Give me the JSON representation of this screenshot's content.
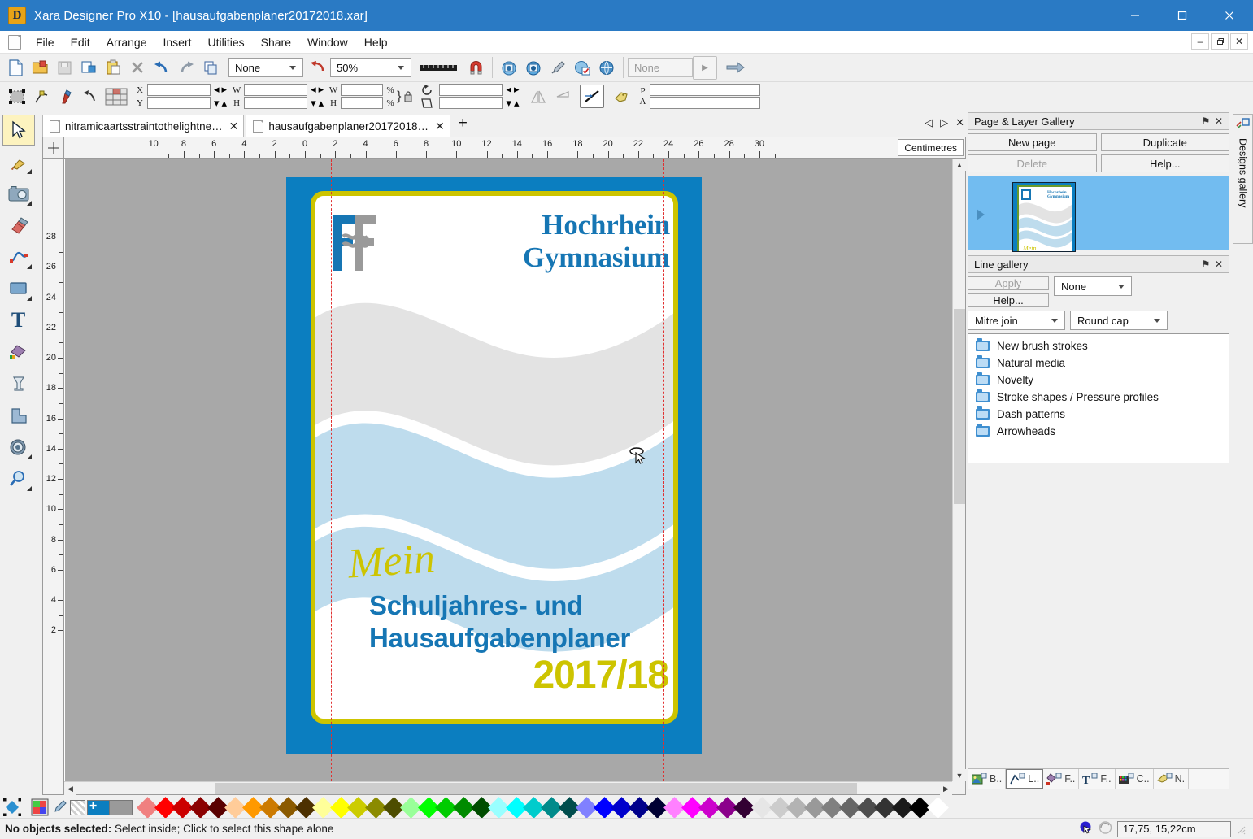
{
  "window": {
    "title": "Xara Designer Pro X10 - [hausaufgabenplaner20172018.xar]",
    "logo_letter": "D",
    "minimize": "—",
    "maximize": "☐",
    "close": "✕"
  },
  "mdi_buttons": {
    "minimize": "–",
    "restore": "❐",
    "close": "✕"
  },
  "menu": {
    "items": [
      "File",
      "Edit",
      "Arrange",
      "Insert",
      "Utilities",
      "Share",
      "Window",
      "Help"
    ]
  },
  "toolbar": {
    "buttons": [
      "new-document-icon",
      "open-document-icon",
      "save-document-icon",
      "print-icon",
      "paste-icon",
      "delete-icon",
      "undo-icon",
      "redo-icon",
      "duplicate-icon"
    ],
    "quality_value": "None",
    "zoom_value": "50%",
    "nav_buttons": [
      "previous-page-icon",
      "next-page-icon",
      "color-picker-icon",
      "web-properties-icon",
      "preview-icon"
    ],
    "name_value": "None",
    "snap_icon": "magnet-icon",
    "ruler_icon": "ruler-icon"
  },
  "infobar": {
    "x_label": "X",
    "y_label": "Y",
    "w_label": "W",
    "h_label": "H",
    "w2_label": "W",
    "h2_label": "H",
    "pct_top": "%",
    "pct_bottom": "%",
    "p_label": "P",
    "a_label": "A",
    "x_value": "",
    "y_value": "",
    "w_value": "",
    "h_value": "",
    "w2_value": "",
    "h2_value": "",
    "p_value": "",
    "a_value": ""
  },
  "tabs": {
    "items": [
      {
        "label": "nitramicaartsstraintothelightne…",
        "active": false
      },
      {
        "label": "hausaufgabenplaner20172018…",
        "active": true
      }
    ],
    "new_tab": "+",
    "close_glyph": "✕",
    "nav_prev": "◁",
    "nav_next": "▷",
    "nav_close": "✕"
  },
  "ruler": {
    "unit_label": "Centimetres",
    "horizontal_labels": [
      "10",
      "8",
      "6",
      "4",
      "2",
      "0",
      "2",
      "4",
      "6",
      "8",
      "10",
      "12",
      "14",
      "16",
      "18",
      "20",
      "22",
      "24",
      "26",
      "28",
      "30"
    ],
    "vertical_labels": [
      "28",
      "26",
      "24",
      "22",
      "20",
      "18",
      "16",
      "14",
      "12",
      "10",
      "8",
      "6",
      "4",
      "2"
    ]
  },
  "document": {
    "school_line1": "Hochrhein",
    "school_line2": "Gymnasium",
    "mein": "Mein",
    "subtitle_line1": "Schuljahres- und",
    "subtitle_line2": "Hausaufgabenplaner",
    "year": "2017/18",
    "colors": {
      "page_blue": "#0b7ec0",
      "border_yellow": "#cdc400",
      "title_blue": "#1676b4",
      "wave_grey": "#e2e2e2",
      "wave_blue": "#bcdcef",
      "logo_grey": "#9a9a9a"
    }
  },
  "page_gallery": {
    "title": "Page & Layer Gallery",
    "pin": "⚑",
    "close": "✕",
    "new_page": "New  page",
    "duplicate": "Duplicate",
    "delete": "Delete",
    "help": "Help..."
  },
  "line_gallery": {
    "title": "Line gallery",
    "pin": "⚑",
    "close": "✕",
    "apply": "Apply",
    "help": "Help...",
    "stroke_value": "None",
    "join_value": "Mitre join",
    "cap_value": "Round cap",
    "folders": [
      "New brush strokes",
      "Natural media",
      "Novelty",
      "Stroke shapes / Pressure profiles",
      "Dash patterns",
      "Arrowheads"
    ]
  },
  "gallery_tabs": [
    {
      "label": "B..",
      "icon": "bitmap-gallery-icon",
      "active": false
    },
    {
      "label": "L..",
      "icon": "line-gallery-icon",
      "active": true
    },
    {
      "label": "F..",
      "icon": "fill-gallery-icon",
      "active": false
    },
    {
      "label": "F..",
      "icon": "font-gallery-icon",
      "active": false
    },
    {
      "label": "C..",
      "icon": "color-gallery-icon",
      "active": false
    },
    {
      "label": "N.",
      "icon": "name-gallery-icon",
      "active": false
    }
  ],
  "designs_gallery": {
    "label": "Designs gallery",
    "icon": "designs-gallery-icon"
  },
  "color_palette": {
    "current_fill": "#0b7ec0",
    "current_line": "#9a9a9a",
    "colors": [
      "#f08080",
      "#ff0000",
      "#cc0000",
      "#8b0000",
      "#5a0000",
      "#ffcc99",
      "#ff9900",
      "#cc7a00",
      "#8b5a00",
      "#4d3000",
      "#ffff99",
      "#ffff00",
      "#cccc00",
      "#8b8b00",
      "#4d4d00",
      "#99ff99",
      "#00ff00",
      "#00cc00",
      "#008b00",
      "#004d00",
      "#99ffff",
      "#00ffff",
      "#00cccc",
      "#008b8b",
      "#004d4d",
      "#8080ff",
      "#0000ff",
      "#0000cc",
      "#00008b",
      "#000033",
      "#ff80ff",
      "#ff00ff",
      "#cc00cc",
      "#8b008b",
      "#330033",
      "#e6e6e6",
      "#cccccc",
      "#b3b3b3",
      "#999999",
      "#808080",
      "#666666",
      "#4d4d4d",
      "#333333",
      "#1a1a1a",
      "#000000",
      "#ffffff"
    ]
  },
  "status": {
    "prefix": "No objects selected:",
    "message": " Select inside; Click to select this shape alone",
    "coordinates": "17,75, 15,22cm"
  }
}
